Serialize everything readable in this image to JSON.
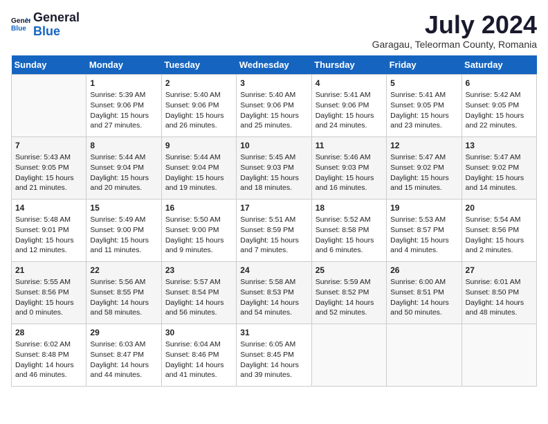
{
  "header": {
    "logo_general": "General",
    "logo_blue": "Blue",
    "month_year": "July 2024",
    "location": "Garagau, Teleorman County, Romania"
  },
  "weekdays": [
    "Sunday",
    "Monday",
    "Tuesday",
    "Wednesday",
    "Thursday",
    "Friday",
    "Saturday"
  ],
  "weeks": [
    [
      {
        "day": "",
        "info": ""
      },
      {
        "day": "1",
        "info": "Sunrise: 5:39 AM\nSunset: 9:06 PM\nDaylight: 15 hours\nand 27 minutes."
      },
      {
        "day": "2",
        "info": "Sunrise: 5:40 AM\nSunset: 9:06 PM\nDaylight: 15 hours\nand 26 minutes."
      },
      {
        "day": "3",
        "info": "Sunrise: 5:40 AM\nSunset: 9:06 PM\nDaylight: 15 hours\nand 25 minutes."
      },
      {
        "day": "4",
        "info": "Sunrise: 5:41 AM\nSunset: 9:06 PM\nDaylight: 15 hours\nand 24 minutes."
      },
      {
        "day": "5",
        "info": "Sunrise: 5:41 AM\nSunset: 9:05 PM\nDaylight: 15 hours\nand 23 minutes."
      },
      {
        "day": "6",
        "info": "Sunrise: 5:42 AM\nSunset: 9:05 PM\nDaylight: 15 hours\nand 22 minutes."
      }
    ],
    [
      {
        "day": "7",
        "info": "Sunrise: 5:43 AM\nSunset: 9:05 PM\nDaylight: 15 hours\nand 21 minutes."
      },
      {
        "day": "8",
        "info": "Sunrise: 5:44 AM\nSunset: 9:04 PM\nDaylight: 15 hours\nand 20 minutes."
      },
      {
        "day": "9",
        "info": "Sunrise: 5:44 AM\nSunset: 9:04 PM\nDaylight: 15 hours\nand 19 minutes."
      },
      {
        "day": "10",
        "info": "Sunrise: 5:45 AM\nSunset: 9:03 PM\nDaylight: 15 hours\nand 18 minutes."
      },
      {
        "day": "11",
        "info": "Sunrise: 5:46 AM\nSunset: 9:03 PM\nDaylight: 15 hours\nand 16 minutes."
      },
      {
        "day": "12",
        "info": "Sunrise: 5:47 AM\nSunset: 9:02 PM\nDaylight: 15 hours\nand 15 minutes."
      },
      {
        "day": "13",
        "info": "Sunrise: 5:47 AM\nSunset: 9:02 PM\nDaylight: 15 hours\nand 14 minutes."
      }
    ],
    [
      {
        "day": "14",
        "info": "Sunrise: 5:48 AM\nSunset: 9:01 PM\nDaylight: 15 hours\nand 12 minutes."
      },
      {
        "day": "15",
        "info": "Sunrise: 5:49 AM\nSunset: 9:00 PM\nDaylight: 15 hours\nand 11 minutes."
      },
      {
        "day": "16",
        "info": "Sunrise: 5:50 AM\nSunset: 9:00 PM\nDaylight: 15 hours\nand 9 minutes."
      },
      {
        "day": "17",
        "info": "Sunrise: 5:51 AM\nSunset: 8:59 PM\nDaylight: 15 hours\nand 7 minutes."
      },
      {
        "day": "18",
        "info": "Sunrise: 5:52 AM\nSunset: 8:58 PM\nDaylight: 15 hours\nand 6 minutes."
      },
      {
        "day": "19",
        "info": "Sunrise: 5:53 AM\nSunset: 8:57 PM\nDaylight: 15 hours\nand 4 minutes."
      },
      {
        "day": "20",
        "info": "Sunrise: 5:54 AM\nSunset: 8:56 PM\nDaylight: 15 hours\nand 2 minutes."
      }
    ],
    [
      {
        "day": "21",
        "info": "Sunrise: 5:55 AM\nSunset: 8:56 PM\nDaylight: 15 hours\nand 0 minutes."
      },
      {
        "day": "22",
        "info": "Sunrise: 5:56 AM\nSunset: 8:55 PM\nDaylight: 14 hours\nand 58 minutes."
      },
      {
        "day": "23",
        "info": "Sunrise: 5:57 AM\nSunset: 8:54 PM\nDaylight: 14 hours\nand 56 minutes."
      },
      {
        "day": "24",
        "info": "Sunrise: 5:58 AM\nSunset: 8:53 PM\nDaylight: 14 hours\nand 54 minutes."
      },
      {
        "day": "25",
        "info": "Sunrise: 5:59 AM\nSunset: 8:52 PM\nDaylight: 14 hours\nand 52 minutes."
      },
      {
        "day": "26",
        "info": "Sunrise: 6:00 AM\nSunset: 8:51 PM\nDaylight: 14 hours\nand 50 minutes."
      },
      {
        "day": "27",
        "info": "Sunrise: 6:01 AM\nSunset: 8:50 PM\nDaylight: 14 hours\nand 48 minutes."
      }
    ],
    [
      {
        "day": "28",
        "info": "Sunrise: 6:02 AM\nSunset: 8:48 PM\nDaylight: 14 hours\nand 46 minutes."
      },
      {
        "day": "29",
        "info": "Sunrise: 6:03 AM\nSunset: 8:47 PM\nDaylight: 14 hours\nand 44 minutes."
      },
      {
        "day": "30",
        "info": "Sunrise: 6:04 AM\nSunset: 8:46 PM\nDaylight: 14 hours\nand 41 minutes."
      },
      {
        "day": "31",
        "info": "Sunrise: 6:05 AM\nSunset: 8:45 PM\nDaylight: 14 hours\nand 39 minutes."
      },
      {
        "day": "",
        "info": ""
      },
      {
        "day": "",
        "info": ""
      },
      {
        "day": "",
        "info": ""
      }
    ]
  ]
}
